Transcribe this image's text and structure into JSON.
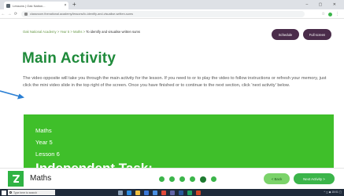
{
  "browser": {
    "tab_title": "Lessons | Oak Nation...",
    "tab_close": "×",
    "new_tab": "+",
    "window_controls": "– ▢ ✕",
    "nav_back": "←",
    "nav_forward": "→",
    "nav_reload": "⟳",
    "url": "classroom.thenational.academy/lessons/to-identify-and-visualise-written-sums",
    "star": "☆",
    "menu": "⋮"
  },
  "page": {
    "breadcrumb_path": "Oak National Academy > Year 5 > Maths > ",
    "breadcrumb_current": "To identify and visualise written sums",
    "schedule_label": "Schedule",
    "full_screen_label": "Full screen",
    "heading": "Main Activity",
    "intro_text": "The video opposite will take you through the main activity for the lesson. If you need to or to play the video to follow instructions or refresh your memory, just click the mini video slide in the top right of the screen. Once you have finished or to continue to the next section, click 'next activity' below."
  },
  "slide": {
    "subject": "Maths",
    "year": "Year 5",
    "lesson": "Lesson 6",
    "task_title": "Independent Task:"
  },
  "player": {
    "subject_label": "Maths",
    "progress": {
      "total_steps": 6,
      "current_step": 5
    },
    "back_label": "< Back",
    "next_label": "Next Activity >"
  },
  "taskbar": {
    "search_placeholder": "Type here to search",
    "tray_text": "^ ◻ ◆ 15:01 ▢"
  },
  "colors": {
    "brand_green": "#3bb54a",
    "heading_green": "#1e8a3a",
    "slide_green": "#3fbf2a",
    "button_purple": "#4a2c4a",
    "arrow_blue": "#2a7fd4",
    "taskbar_dark": "#1f2a3a"
  },
  "icons": {
    "logo": "oak-acorn-logo",
    "arrow": "annotation-arrow-right"
  }
}
